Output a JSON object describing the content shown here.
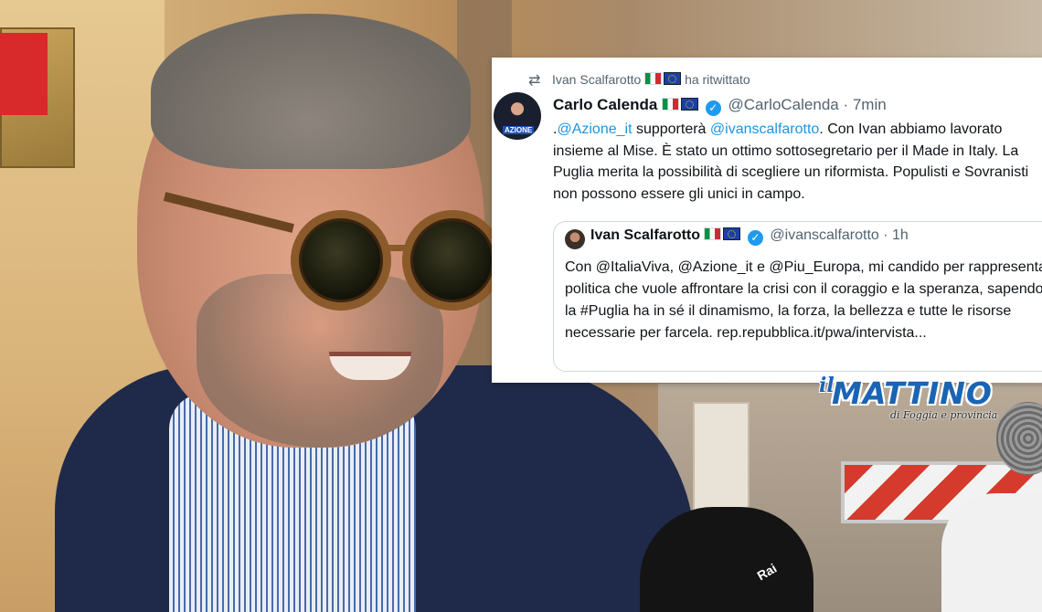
{
  "photo": {
    "mic_label": "Rai"
  },
  "retweet": {
    "user": "Ivan Scalfarotto",
    "action": "ha ritwittato"
  },
  "tweet": {
    "author_name": "Carlo Calenda",
    "author_handle": "@CarloCalenda",
    "time": "· 7min",
    "avatar_tag": "AZIONE",
    "body_prefix": ".",
    "mention_1": "@Azione_it",
    "body_part_1": " supporterà ",
    "mention_2": "@ivanscalfarotto",
    "body_part_2": ". Con Ivan abbiamo lavorato insieme al Mise. È stato un ottimo sottosegretario per il Made in Italy. La Puglia merita la possibilità di scegliere un riformista. Populisti e Sovranisti non possono essere  gli unici in campo."
  },
  "quoted_tweet": {
    "author_name": "Ivan Scalfarotto",
    "author_handle": "@ivanscalfarotto",
    "time": "· 1h",
    "body": "Con @ItaliaViva, @Azione_it e @Piu_Europa, mi candido per rappresentare la politica che vuole affrontare la crisi con il coraggio e la speranza, sapendo che la #Puglia ha in sé il dinamismo, la forza, la bellezza e tutte le risorse necessarie per farcela. rep.repubblica.it/pwa/intervista..."
  },
  "logo": {
    "prefix": "il",
    "name": "MATTINO",
    "subtitle": "di Foggia e provincia"
  },
  "colors": {
    "link": "#1b95e0",
    "verified": "#1d9bf0",
    "logo_blue": "#1a64b4"
  },
  "icons": [
    "retweet-icon",
    "verified-badge-icon",
    "italy-flag-icon",
    "eu-flag-icon"
  ]
}
